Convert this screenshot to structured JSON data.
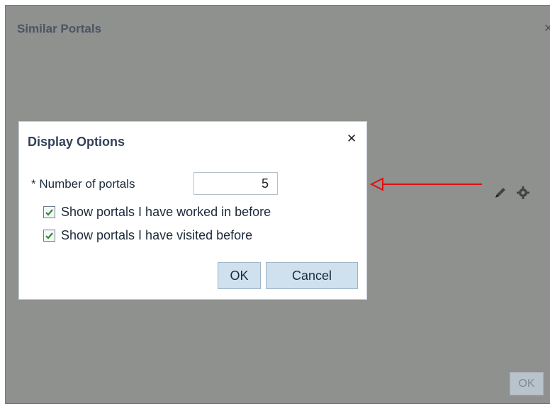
{
  "background_panel": {
    "title": "Similar Portals",
    "close_glyph": "✕",
    "ok_label": "OK",
    "tool_icons": [
      "pencil-icon",
      "settings-icon"
    ]
  },
  "annotation": {
    "arrow_color": "#e01010"
  },
  "dialog": {
    "title": "Display Options",
    "close_glyph": "✕",
    "number_label": "* Number of portals",
    "number_value": "5",
    "options": [
      {
        "label": "Show portals I have worked in before",
        "checked": true
      },
      {
        "label": "Show portals I have visited before",
        "checked": true
      }
    ],
    "ok_label": "OK",
    "cancel_label": "Cancel"
  },
  "colors": {
    "overlay": "#8f918f",
    "dialog_title": "#33415a",
    "button_fill": "#cfe0ee",
    "checkmark": "#2f8a2f"
  }
}
